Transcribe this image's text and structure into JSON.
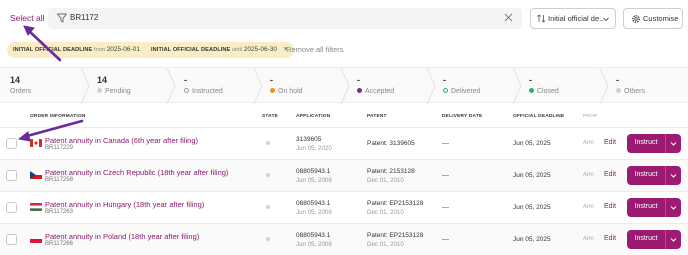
{
  "toolbar": {
    "select_all_label": "Select all",
    "search_value": "BR1172",
    "dropdown_label": "Initial official de...",
    "customise_label": "Customise"
  },
  "filters": {
    "chips": [
      {
        "field": "INITIAL OFFICIAL DEADLINE",
        "operator": "from",
        "value": "2025-06-01"
      },
      {
        "field": "INITIAL OFFICIAL DEADLINE",
        "operator": "until",
        "value": "2025-06-30"
      }
    ],
    "remove_all_label": "Remove all filters"
  },
  "status_summary": [
    {
      "count": "14",
      "label": "Orders",
      "dot": ""
    },
    {
      "count": "14",
      "label": "Pending",
      "dot": "#cfcfcf"
    },
    {
      "count": "-",
      "label": "Instructed",
      "dot": "#ffffff"
    },
    {
      "count": "-",
      "label": "On hold",
      "dot": "#f08c2a"
    },
    {
      "count": "-",
      "label": "Accepted",
      "dot": "#7b2a8c"
    },
    {
      "count": "-",
      "label": "Delivered",
      "dot": "#ffffff"
    },
    {
      "count": "-",
      "label": "Closed",
      "dot": "#2fb36b"
    },
    {
      "count": "-",
      "label": "Others",
      "dot": "#cfcfcf"
    }
  ],
  "table": {
    "columns": {
      "order_information": "ORDER INFORMATION",
      "state": "STATE",
      "application": "APPLICATION",
      "patent": "PATENT",
      "delivery_date": "DELIVERY DATE",
      "official_deadline": "OFFICIAL DEADLINE",
      "prop": "PROP"
    },
    "rows": [
      {
        "flag": "canada",
        "name": "Patent annuity in Canada (6th year after filing)",
        "id": "BR117229",
        "app_no": "3139605",
        "app_date": "Jun 05, 2020",
        "patent_no": "Patent: 3139605",
        "patent_date": "",
        "delivery": "—",
        "deadline": "Jun 05, 2025",
        "prop": "Ann",
        "edit": "Edit",
        "instruct": "Instruct"
      },
      {
        "flag": "czech",
        "name": "Patent annuity in Czech Republic (18th year after filing)",
        "id": "BR117258",
        "app_no": "08805943.1",
        "app_date": "Jun 05, 2008",
        "patent_no": "Patent: 2153128",
        "patent_date": "Dec 01, 2010",
        "delivery": "—",
        "deadline": "Jun 05, 2025",
        "prop": "Ann",
        "edit": "Edit",
        "instruct": "Instruct"
      },
      {
        "flag": "hungary",
        "name": "Patent annuity in Hungary (18th year after filing)",
        "id": "BR117263",
        "app_no": "08805943.1",
        "app_date": "Jun 05, 2008",
        "patent_no": "Patent: EP2153128",
        "patent_date": "Dec 01, 2010",
        "delivery": "—",
        "deadline": "Jun 05, 2025",
        "prop": "Ann",
        "edit": "Edit",
        "instruct": "Instruct"
      },
      {
        "flag": "poland",
        "name": "Patent annuity in Poland (18th year after filing)",
        "id": "BR117266",
        "app_no": "08805943.1",
        "app_date": "Jun 05, 2008",
        "patent_no": "Patent: EP2153128",
        "patent_date": "Dec 01, 2010",
        "delivery": "—",
        "deadline": "Jun 05, 2025",
        "prop": "Ann",
        "edit": "Edit",
        "instruct": "Instruct"
      }
    ]
  },
  "colors": {
    "brand": "#9b1b72",
    "link": "#8a1a6e",
    "chip_bg": "#f8edc4",
    "annotation_arrow": "#6a2a9a"
  }
}
